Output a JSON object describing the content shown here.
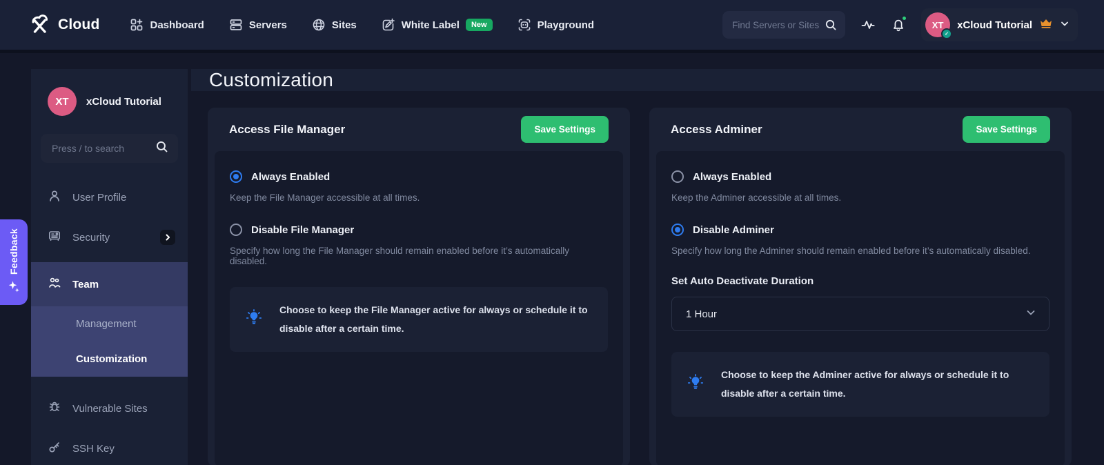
{
  "navbar": {
    "brand": "Cloud",
    "items": [
      {
        "label": "Dashboard"
      },
      {
        "label": "Servers"
      },
      {
        "label": "Sites"
      },
      {
        "label": "White Label",
        "badge": "New"
      },
      {
        "label": "Playground"
      }
    ],
    "search_placeholder": "Find Servers or Sites",
    "user": {
      "initials": "XT",
      "name": "xCloud Tutorial"
    }
  },
  "sidebar": {
    "profile": {
      "initials": "XT",
      "name": "xCloud Tutorial"
    },
    "search_placeholder": "Press / to search",
    "items": {
      "user_profile": "User Profile",
      "security": "Security",
      "team": "Team",
      "management": "Management",
      "customization": "Customization",
      "vulnerable_sites": "Vulnerable Sites",
      "ssh_key": "SSH Key"
    }
  },
  "feedback_label": "Feedback",
  "page": {
    "title": "Customization"
  },
  "cards": [
    {
      "title": "Access File Manager",
      "save_label": "Save Settings",
      "options": [
        {
          "label": "Always Enabled",
          "selected": true,
          "desc": "Keep the File Manager accessible at all times."
        },
        {
          "label": "Disable File Manager",
          "selected": false,
          "desc": "Specify how long the File Manager should remain enabled before it’s automatically disabled."
        }
      ],
      "tip": "Choose to keep the File Manager active for always or schedule it to disable after a certain time."
    },
    {
      "title": "Access Adminer",
      "save_label": "Save Settings",
      "options": [
        {
          "label": "Always Enabled",
          "selected": false,
          "desc": "Keep the Adminer accessible at all times."
        },
        {
          "label": "Disable Adminer",
          "selected": true,
          "desc": "Specify how long the Adminer should remain enabled before it’s automatically disabled."
        }
      ],
      "duration_label": "Set Auto Deactivate Duration",
      "duration_value": "1 Hour",
      "tip": "Choose to keep the Adminer active for always or schedule it to disable after a certain time."
    }
  ],
  "colors": {
    "accent_green": "#2ebe71",
    "accent_blue": "#2e7cf0",
    "accent_purple": "#6c5bf5",
    "avatar_pink": "#dc5b83",
    "crown_orange": "#e8912d",
    "badge_green": "#17a861",
    "online_dot_green": "#2ecf7c"
  }
}
